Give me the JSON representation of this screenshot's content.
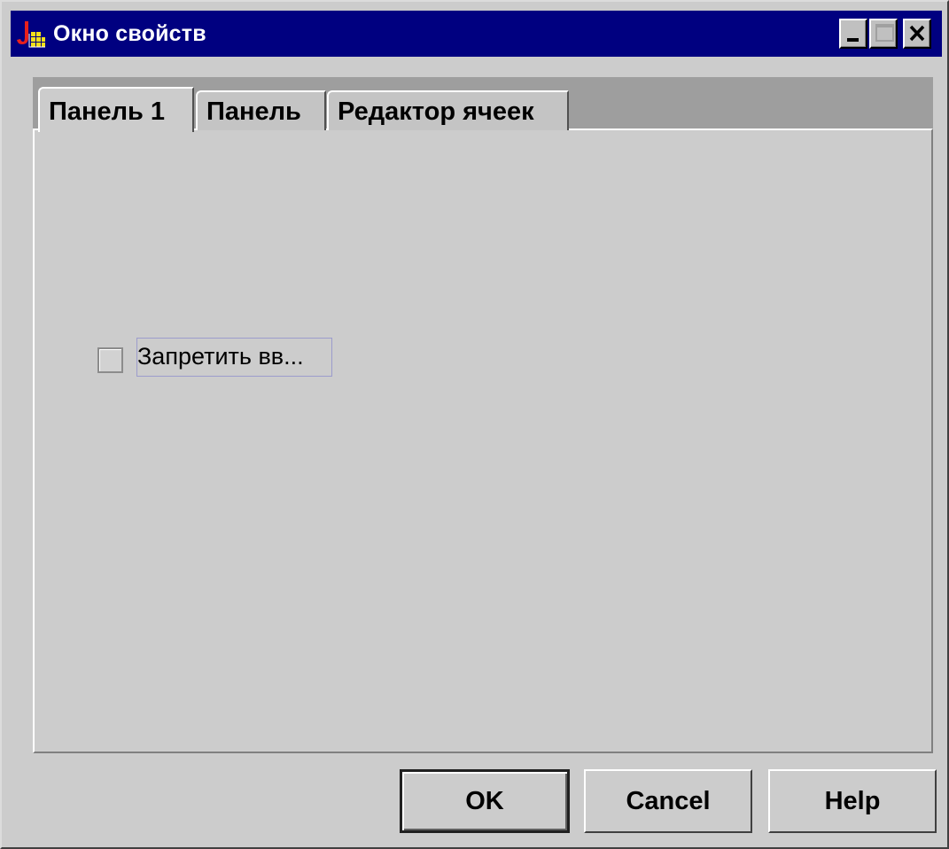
{
  "window": {
    "title": "Окно свойств",
    "controls": {
      "minimize": "minimize",
      "maximize": "maximize",
      "close": "close"
    }
  },
  "tabs": [
    {
      "label": "Панель 1",
      "selected": true
    },
    {
      "label": "Панель",
      "selected": false
    },
    {
      "label": "Редактор ячеек",
      "selected": false
    }
  ],
  "panel": {
    "checkbox": {
      "label": "Запретить вв...",
      "checked": false
    }
  },
  "buttons": {
    "ok": "OK",
    "cancel": "Cancel",
    "help": "Help"
  },
  "colors": {
    "titlebar": "#000080",
    "title_text": "#ffffff",
    "window_bg": "#cccccc",
    "tab_strip_bg": "#9e9e9e",
    "focus_border": "#9c9ccc"
  },
  "icons": {
    "app": "java-app-icon",
    "minimize": "minimize-icon",
    "maximize": "maximize-icon",
    "close": "close-icon"
  }
}
